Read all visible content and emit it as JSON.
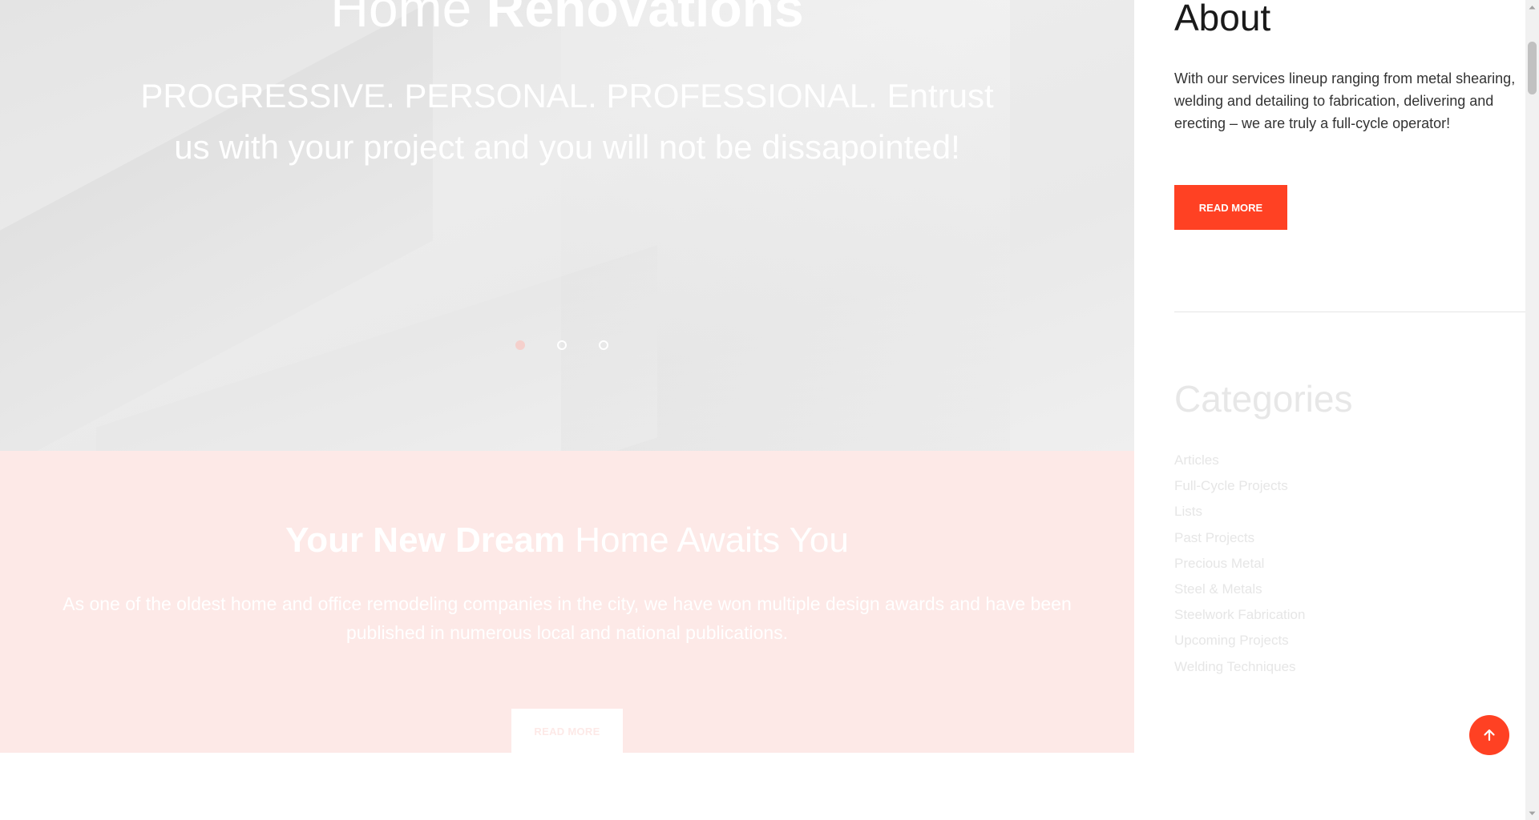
{
  "hero": {
    "title_regular": "Home",
    "title_bold": "Renovations",
    "subtitle": "PROGRESSIVE. PERSONAL. PROFESSIONAL. Entrust us with your project and you will not be dissapointed!",
    "slides": [
      {
        "active": true
      },
      {
        "active": false
      },
      {
        "active": false
      }
    ]
  },
  "promo": {
    "title_bold": "Your New Dream",
    "title_regular": "Home Awaits You",
    "text": "As one of the oldest home and office remodeling companies in the city, we have won multiple design awards and have been published in numerous local and national publications.",
    "button_label": "READ MORE"
  },
  "sidebar": {
    "about": {
      "title": "About",
      "text": "With our services lineup ranging from metal shearing, welding and detailing to fabrication, delivering and erecting – we are truly a full-cycle operator!",
      "button_label": "READ MORE"
    },
    "categories": {
      "title": "Categories",
      "items": [
        "Articles",
        "Full-Cycle Projects",
        "Lists",
        "Past Projects",
        "Precious Metal",
        "Steel & Metals",
        "Steelwork Fabrication",
        "Upcoming Projects",
        "Welding Techniques"
      ]
    }
  },
  "scroll_top": {
    "icon": "arrow-up-icon"
  },
  "colors": {
    "accent": "#ff4123",
    "promo_bg": "#fde9e7",
    "hero_bg": "#e9e9e9"
  }
}
